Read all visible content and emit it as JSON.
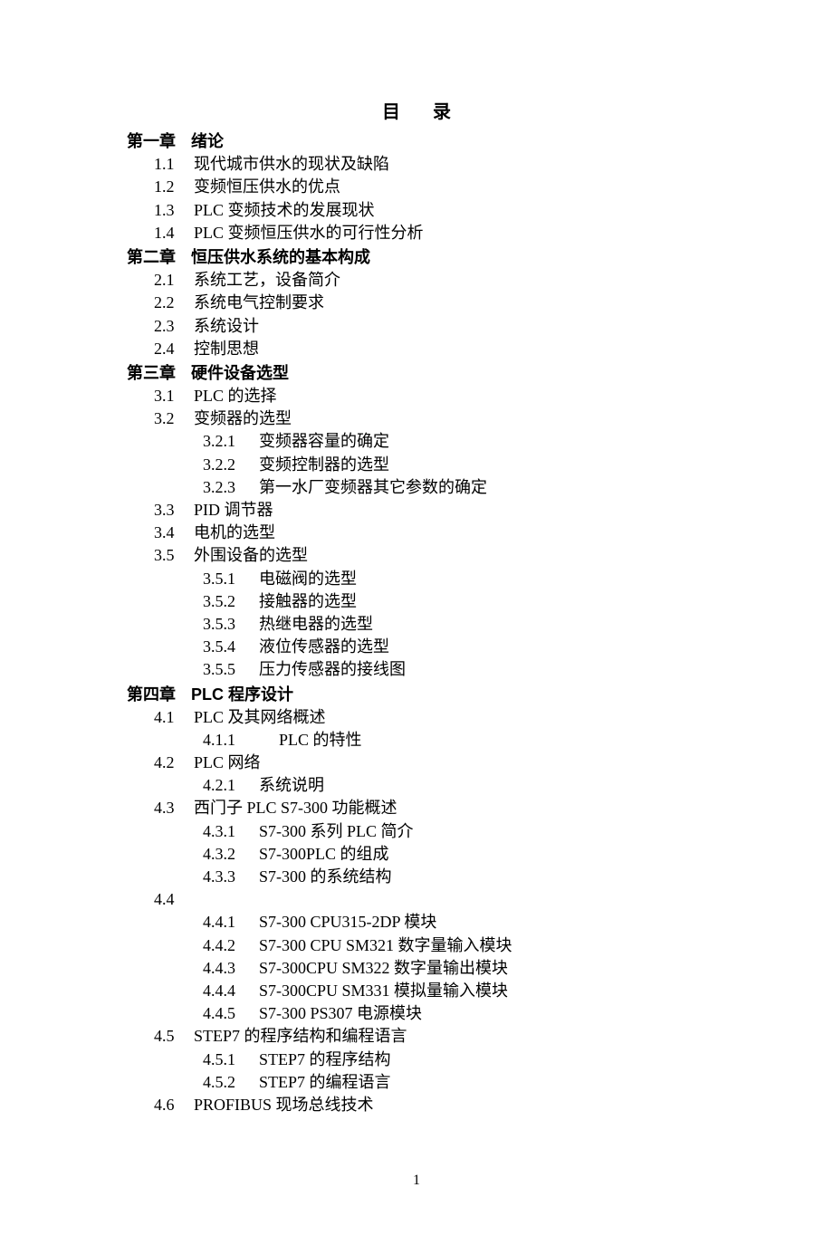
{
  "title": "目录",
  "chapters": [
    {
      "label": "第一章",
      "name": "绪论",
      "sections": [
        {
          "num": "1.1",
          "text": "现代城市供水的现状及缺陷"
        },
        {
          "num": "1.2",
          "text": "变频恒压供水的优点"
        },
        {
          "num": "1.3",
          "text": "PLC 变频技术的发展现状"
        },
        {
          "num": "1.4",
          "text": "PLC 变频恒压供水的可行性分析"
        }
      ]
    },
    {
      "label": "第二章",
      "name": "恒压供水系统的基本构成",
      "sections": [
        {
          "num": "2.1",
          "text": "系统工艺，设备简介"
        },
        {
          "num": "2.2",
          "text": "系统电气控制要求"
        },
        {
          "num": "2.3",
          "text": "系统设计"
        },
        {
          "num": "2.4",
          "text": "控制思想"
        }
      ]
    },
    {
      "label": "第三章",
      "name": "硬件设备选型",
      "sections": [
        {
          "num": "3.1",
          "text": "PLC 的选择"
        },
        {
          "num": "3.2",
          "text": "变频器的选型",
          "subs": [
            {
              "num": "3.2.1",
              "text": "变频器容量的确定"
            },
            {
              "num": "3.2.2",
              "text": "变频控制器的选型"
            },
            {
              "num": "3.2.3",
              "text": "第一水厂变频器其它参数的确定"
            }
          ]
        },
        {
          "num": "3.3",
          "text": "PID 调节器"
        },
        {
          "num": "3.4",
          "text": "电机的选型"
        },
        {
          "num": "3.5",
          "text": "外围设备的选型",
          "subs": [
            {
              "num": "3.5.1",
              "text": "电磁阀的选型"
            },
            {
              "num": "3.5.2",
              "text": "接触器的选型"
            },
            {
              "num": "3.5.3",
              "text": "热继电器的选型"
            },
            {
              "num": "3.5.4",
              "text": "液位传感器的选型"
            },
            {
              "num": "3.5.5",
              "text": "压力传感器的接线图"
            }
          ]
        }
      ]
    },
    {
      "label": "第四章",
      "name": "PLC 程序设计",
      "sections": [
        {
          "num": "4.1",
          "text": "PLC 及其网络概述",
          "subs": [
            {
              "num": "4.1.1",
              "text": "PLC 的特性",
              "wide": true
            }
          ]
        },
        {
          "num": "4.2",
          "text": "PLC 网络",
          "subs": [
            {
              "num": "4.2.1",
              "text": "系统说明"
            }
          ]
        },
        {
          "num": "4.3",
          "text": "西门子 PLC S7-300 功能概述",
          "subs": [
            {
              "num": "4.3.1",
              "text": "S7-300 系列 PLC 简介"
            },
            {
              "num": "4.3.2",
              "text": "S7-300PLC 的组成"
            },
            {
              "num": "4.3.3",
              "text": "S7-300 的系统结构"
            }
          ]
        },
        {
          "num": "4.4",
          "text": "",
          "subs": [
            {
              "num": "4.4.1",
              "text": "S7-300 CPU315-2DP 模块"
            },
            {
              "num": "4.4.2",
              "text": "S7-300 CPU SM321 数字量输入模块"
            },
            {
              "num": "4.4.3",
              "text": "S7-300CPU SM322 数字量输出模块"
            },
            {
              "num": "4.4.4",
              "text": "S7-300CPU SM331 模拟量输入模块"
            },
            {
              "num": "4.4.5",
              "text": "S7-300 PS307 电源模块"
            }
          ]
        },
        {
          "num": "4.5",
          "text": "STEP7 的程序结构和编程语言",
          "subs": [
            {
              "num": "4.5.1",
              "text": "STEP7 的程序结构"
            },
            {
              "num": "4.5.2",
              "text": "STEP7 的编程语言"
            }
          ]
        },
        {
          "num": "4.6",
          "text": "PROFIBUS 现场总线技术"
        }
      ]
    }
  ],
  "pageNumber": "1"
}
